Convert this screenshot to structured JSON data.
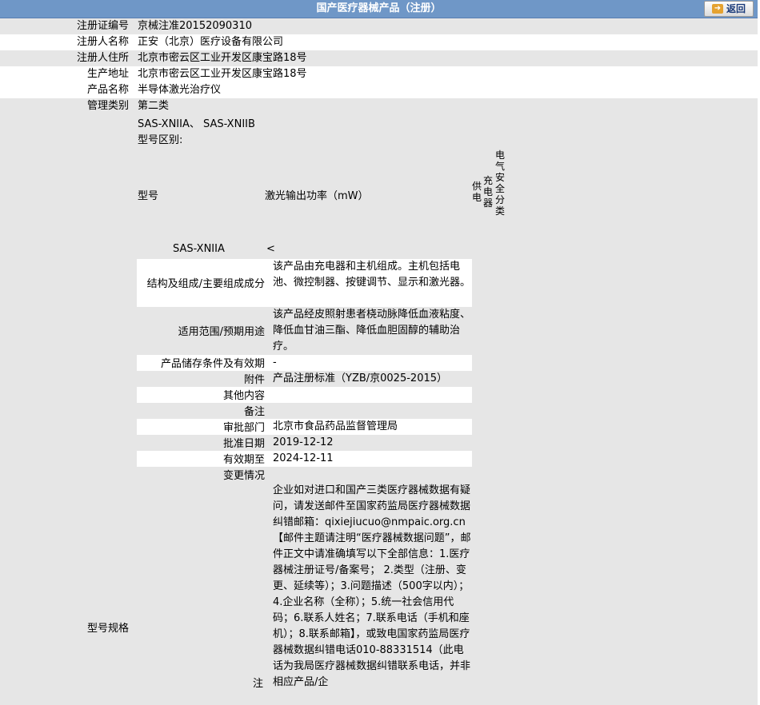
{
  "header": {
    "title": "国产医疗器械产品（注册）",
    "back_label": "返回"
  },
  "fields": [
    {
      "label": "注册证编号",
      "value": "京械注准20152090310"
    },
    {
      "label": "注册人名称",
      "value": "正安（北京）医疗设备有限公司"
    },
    {
      "label": "注册人住所",
      "value": "北京市密云区工业开发区康宝路18号"
    },
    {
      "label": "生产地址",
      "value": "北京市密云区工业开发区康宝路18号"
    },
    {
      "label": "产品名称",
      "value": "半导体激光治疗仪"
    },
    {
      "label": "管理类别",
      "value": "第二类"
    }
  ],
  "spec": {
    "label": "型号规格",
    "models": "SAS-XNIIA、 SAS-XNIIB",
    "distinction_label": "型号区别:",
    "table": {
      "col_model": "型号",
      "col_power": "激光输出功率（mW）",
      "col_power_supply": "供电",
      "col_charger": "充电器",
      "col_safety": "电气安全分类",
      "row_model": "SAS-XNIIA",
      "row_power": "<"
    }
  },
  "details": [
    {
      "label": "结构及组成/主要组成成分",
      "value": "该产品由充电器和主机组成。主机包括电池、微控制器、按键调节、显示和激光器。"
    },
    {
      "label": "适用范围/预期用途",
      "value": "该产品经皮照射患者桡动脉降低血液粘度、降低血甘油三酯、降低血胆固醇的辅助治疗。"
    },
    {
      "label": "产品储存条件及有效期",
      "value": "-"
    },
    {
      "label": "附件",
      "value": "产品注册标准（YZB/京0025-2015）"
    },
    {
      "label": "其他内容",
      "value": ""
    },
    {
      "label": "备注",
      "value": ""
    },
    {
      "label": "审批部门",
      "value": "北京市食品药品监督管理局"
    },
    {
      "label": "批准日期",
      "value": "2019-12-12"
    },
    {
      "label": "有效期至",
      "value": "2024-12-11"
    },
    {
      "label": "变更情况",
      "value": ""
    }
  ],
  "note": {
    "label": "注",
    "text": "企业如对进口和国产三类医疗器械数据有疑问，请发送邮件至国家药监局医疗器械数据纠错邮箱：qixiejiucuo@nmpaic.org.cn【邮件主题请注明“医疗器械数据问题”，邮件正文中请准确填写以下全部信息：1.医疗器械注册证号/备案号； 2.类型（注册、变更、延续等）；3.问题描述（500字以内）；4.企业名称（全称）；5.统一社会信用代码；6.联系人姓名；7.联系电话（手机和座机）；8.联系邮箱】，或致电国家药监局医疗器械数据纠错电话010-88331514（此电话为我局医疗器械数据纠错联系电话，并非相应产品/企"
  }
}
